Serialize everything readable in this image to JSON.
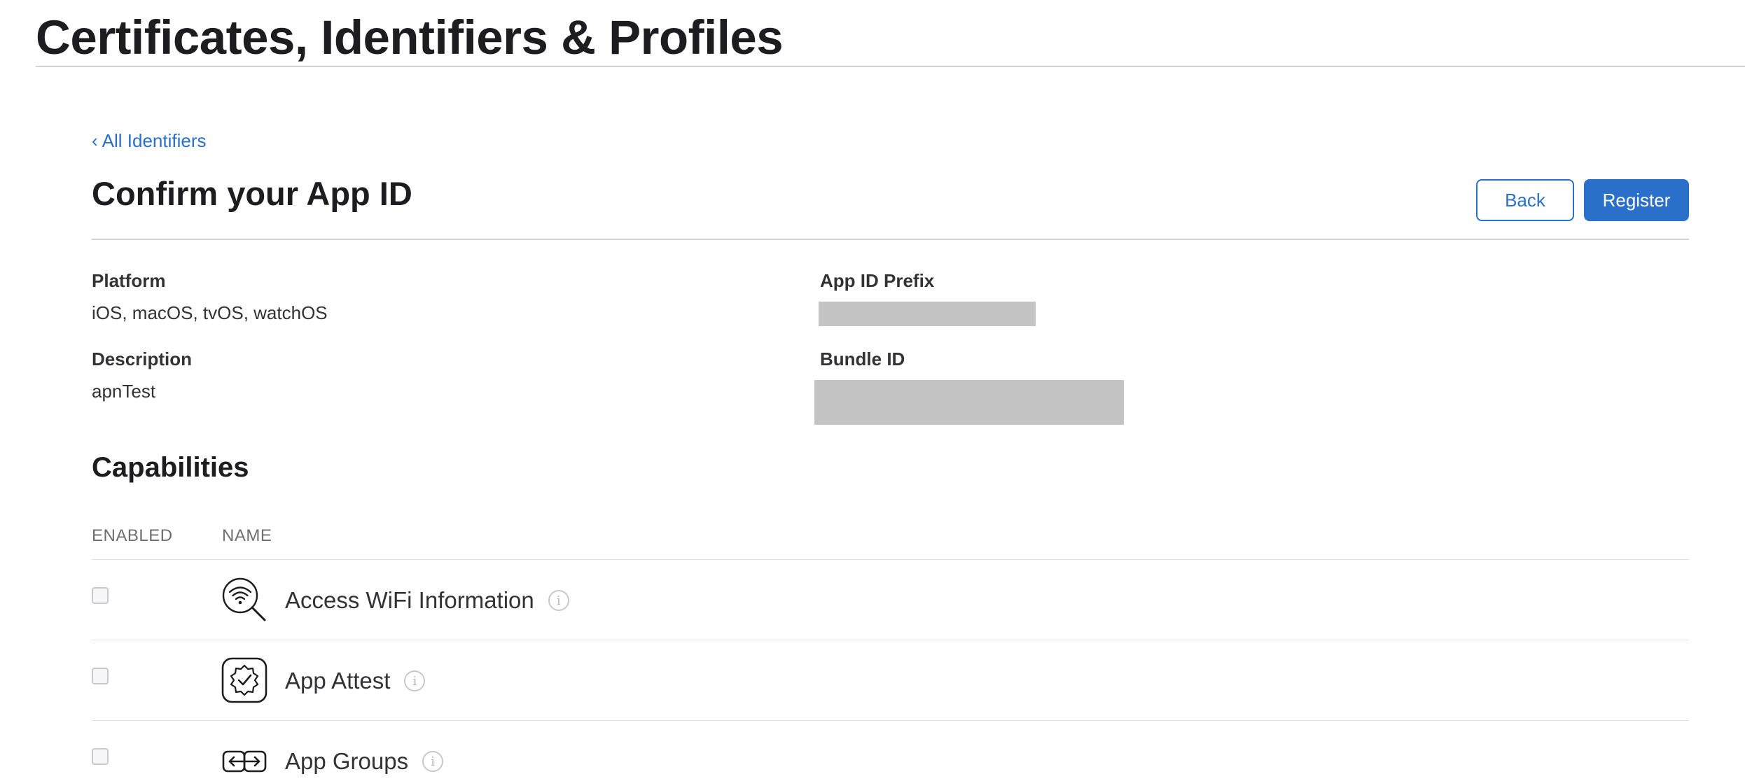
{
  "site": {
    "title": "Certificates, Identifiers & Profiles"
  },
  "nav": {
    "back_link_chevron": "‹",
    "back_link_label": "All Identifiers"
  },
  "page": {
    "heading": "Confirm your App ID"
  },
  "actions": {
    "back_label": "Back",
    "register_label": "Register"
  },
  "details": {
    "platform_label": "Platform",
    "platform_value": "iOS, macOS, tvOS, watchOS",
    "description_label": "Description",
    "description_value": "apnTest",
    "app_id_prefix_label": "App ID Prefix",
    "bundle_id_label": "Bundle ID"
  },
  "capabilities": {
    "heading": "Capabilities",
    "columns": {
      "enabled": "ENABLED",
      "name": "NAME"
    },
    "info_glyph": "i",
    "items": [
      {
        "name": "Access WiFi Information",
        "icon": "wifi-search-icon",
        "enabled": false
      },
      {
        "name": "App Attest",
        "icon": "verified-badge-icon",
        "enabled": false
      },
      {
        "name": "App Groups",
        "icon": "app-groups-icon",
        "enabled": false
      }
    ]
  }
}
